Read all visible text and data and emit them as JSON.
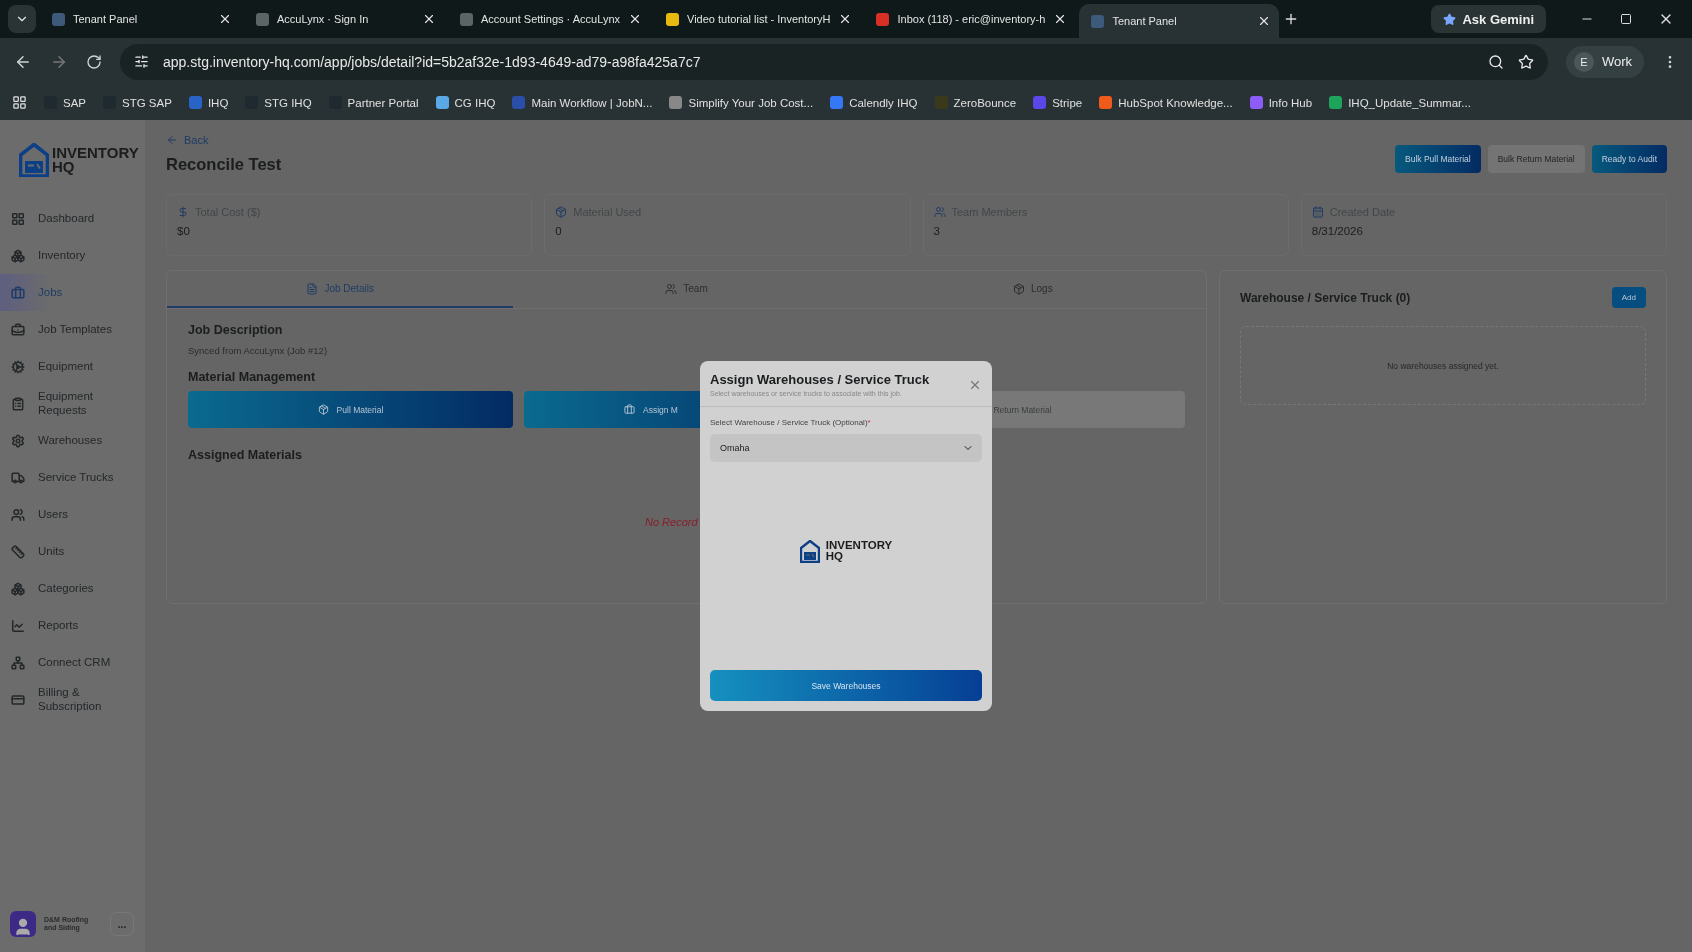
{
  "browser": {
    "tabs": [
      {
        "title": "Tenant Panel",
        "selected": false
      },
      {
        "title": "AccuLynx · Sign In",
        "selected": false
      },
      {
        "title": "Account Settings · AccuLynx",
        "selected": false
      },
      {
        "title": "Video tutorial list - InventoryH",
        "selected": false
      },
      {
        "title": "Inbox (118) - eric@inventory-h",
        "selected": false
      },
      {
        "title": "Tenant Panel",
        "selected": true
      }
    ],
    "gemini": "Ask Gemini",
    "url": "app.stg.inventory-hq.com/app/jobs/detail?id=5b2af32e-1d93-4649-ad79-a98fa425a7c7",
    "profile": {
      "initial": "E",
      "label": "Work"
    },
    "bookmarks": [
      "SAP",
      "STG SAP",
      "IHQ",
      "STG IHQ",
      "Partner Portal",
      "CG IHQ",
      "Main Workflow | JobN...",
      "Simplify Your Job Cost...",
      "Calendly IHQ",
      "ZeroBounce",
      "Stripe",
      "HubSpot Knowledge...",
      "Info Hub",
      "IHQ_Update_Summar..."
    ]
  },
  "sidebar": {
    "logo": {
      "line1": "INVENTORY",
      "line2": "HQ"
    },
    "items": [
      {
        "label": "Dashboard",
        "selected": false
      },
      {
        "label": "Inventory",
        "selected": false
      },
      {
        "label": "Jobs",
        "selected": true
      },
      {
        "label": "Job Templates",
        "selected": false
      },
      {
        "label": "Equipment",
        "selected": false
      },
      {
        "label": "Equipment Requests",
        "selected": false
      },
      {
        "label": "Warehouses",
        "selected": false
      },
      {
        "label": "Service Trucks",
        "selected": false
      },
      {
        "label": "Users",
        "selected": false
      },
      {
        "label": "Units",
        "selected": false
      },
      {
        "label": "Categories",
        "selected": false
      },
      {
        "label": "Reports",
        "selected": false
      },
      {
        "label": "Connect CRM",
        "selected": false
      },
      {
        "label": "Billing & Subscription",
        "selected": false
      }
    ],
    "account": {
      "name": "D&M Roofing and Siding",
      "menu": "..."
    }
  },
  "header": {
    "back": "Back",
    "title": "Reconcile Test",
    "actions": [
      {
        "label": "Bulk Pull Material",
        "kind": "primary"
      },
      {
        "label": "Bulk Return Material",
        "kind": "secondary"
      },
      {
        "label": "Ready to Audit",
        "kind": "primary"
      }
    ]
  },
  "stats": [
    {
      "label": "Total Cost ($)",
      "value": "$0"
    },
    {
      "label": "Material Used",
      "value": "0"
    },
    {
      "label": "Team Members",
      "value": "3"
    },
    {
      "label": "Created Date",
      "value": "8/31/2026"
    }
  ],
  "tabs": [
    {
      "label": "Job Details",
      "selected": true
    },
    {
      "label": "Team",
      "selected": false
    },
    {
      "label": "Logs",
      "selected": false
    }
  ],
  "job": {
    "description_title": "Job Description",
    "description": "Synced from AccuLynx (Job #12)",
    "material_title": "Material Management",
    "material_buttons": [
      {
        "label": "Pull Material",
        "kind": "primary"
      },
      {
        "label": "Assign M",
        "kind": "primary"
      },
      {
        "label": "Return Material",
        "kind": "secondary"
      }
    ],
    "assigned_title": "Assigned Materials",
    "empty": "No Record"
  },
  "warehouses": {
    "title": "Warehouse / Service Truck (0)",
    "add": "Add",
    "empty": "No warehouses assigned yet."
  },
  "modal": {
    "title": "Assign Warehouses / Service Truck",
    "subtitle": "Select warehouses or service trucks to associate with this job.",
    "label": "Select Warehouse / Service Truck (Optional)",
    "required": "*",
    "value": "Omaha",
    "logo": {
      "line1": "INVENTORY",
      "line2": "HQ"
    },
    "save": "Save Warehouses"
  }
}
